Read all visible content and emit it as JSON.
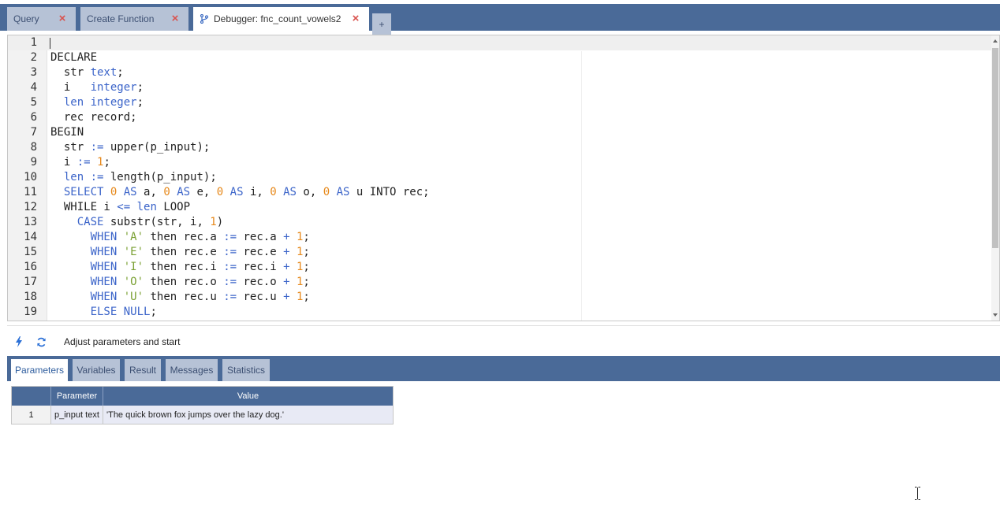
{
  "tabs": [
    {
      "label": "Query",
      "active": false
    },
    {
      "label": "Create Function",
      "active": false
    },
    {
      "label": "Debugger: fnc_count_vowels2",
      "active": true,
      "icon": "branch-icon"
    }
  ],
  "new_tab_label": "+",
  "editor": {
    "current_line": 1,
    "lines": [
      {
        "n": "1",
        "tokens": []
      },
      {
        "n": "2",
        "tokens": [
          [
            "DECLARE",
            ""
          ]
        ]
      },
      {
        "n": "3",
        "tokens": [
          [
            "  str ",
            ""
          ],
          [
            "text",
            "kw"
          ],
          [
            ";",
            ""
          ]
        ]
      },
      {
        "n": "4",
        "tokens": [
          [
            "  i   ",
            ""
          ],
          [
            "integer",
            "kw"
          ],
          [
            ";",
            ""
          ]
        ]
      },
      {
        "n": "5",
        "tokens": [
          [
            "  ",
            ""
          ],
          [
            "len",
            "kw"
          ],
          [
            " ",
            ""
          ],
          [
            "integer",
            "kw"
          ],
          [
            ";",
            ""
          ]
        ]
      },
      {
        "n": "6",
        "tokens": [
          [
            "  rec record;",
            ""
          ]
        ]
      },
      {
        "n": "7",
        "tokens": [
          [
            "BEGIN",
            ""
          ]
        ]
      },
      {
        "n": "8",
        "tokens": [
          [
            "  str ",
            ""
          ],
          [
            ":=",
            "kw"
          ],
          [
            " upper(p_input);",
            ""
          ]
        ]
      },
      {
        "n": "9",
        "tokens": [
          [
            "  i ",
            ""
          ],
          [
            ":=",
            "kw"
          ],
          [
            " ",
            ""
          ],
          [
            "1",
            "num"
          ],
          [
            ";",
            ""
          ]
        ]
      },
      {
        "n": "10",
        "tokens": [
          [
            "  ",
            ""
          ],
          [
            "len",
            "kw"
          ],
          [
            " ",
            ""
          ],
          [
            ":=",
            "kw"
          ],
          [
            " length(p_input);",
            ""
          ]
        ]
      },
      {
        "n": "11",
        "tokens": [
          [
            "  ",
            ""
          ],
          [
            "SELECT",
            "kw"
          ],
          [
            " ",
            ""
          ],
          [
            "0",
            "num"
          ],
          [
            " ",
            ""
          ],
          [
            "AS",
            "kw"
          ],
          [
            " a, ",
            ""
          ],
          [
            "0",
            "num"
          ],
          [
            " ",
            ""
          ],
          [
            "AS",
            "kw"
          ],
          [
            " e, ",
            ""
          ],
          [
            "0",
            "num"
          ],
          [
            " ",
            ""
          ],
          [
            "AS",
            "kw"
          ],
          [
            " i, ",
            ""
          ],
          [
            "0",
            "num"
          ],
          [
            " ",
            ""
          ],
          [
            "AS",
            "kw"
          ],
          [
            " o, ",
            ""
          ],
          [
            "0",
            "num"
          ],
          [
            " ",
            ""
          ],
          [
            "AS",
            "kw"
          ],
          [
            " u INTO rec;",
            ""
          ]
        ]
      },
      {
        "n": "12",
        "tokens": [
          [
            "  WHILE i ",
            ""
          ],
          [
            "<=",
            "kw"
          ],
          [
            " ",
            ""
          ],
          [
            "len",
            "kw"
          ],
          [
            " LOOP",
            ""
          ]
        ]
      },
      {
        "n": "13",
        "tokens": [
          [
            "    ",
            ""
          ],
          [
            "CASE",
            "kw"
          ],
          [
            " substr(str, i, ",
            ""
          ],
          [
            "1",
            "num"
          ],
          [
            ")",
            ""
          ]
        ]
      },
      {
        "n": "14",
        "tokens": [
          [
            "      ",
            ""
          ],
          [
            "WHEN",
            "kw"
          ],
          [
            " ",
            ""
          ],
          [
            "'A'",
            "str"
          ],
          [
            " then rec.a ",
            ""
          ],
          [
            ":=",
            "kw"
          ],
          [
            " rec.a ",
            ""
          ],
          [
            "+",
            "kw"
          ],
          [
            " ",
            ""
          ],
          [
            "1",
            "num"
          ],
          [
            ";",
            ""
          ]
        ]
      },
      {
        "n": "15",
        "tokens": [
          [
            "      ",
            ""
          ],
          [
            "WHEN",
            "kw"
          ],
          [
            " ",
            ""
          ],
          [
            "'E'",
            "str"
          ],
          [
            " then rec.e ",
            ""
          ],
          [
            ":=",
            "kw"
          ],
          [
            " rec.e ",
            ""
          ],
          [
            "+",
            "kw"
          ],
          [
            " ",
            ""
          ],
          [
            "1",
            "num"
          ],
          [
            ";",
            ""
          ]
        ]
      },
      {
        "n": "16",
        "tokens": [
          [
            "      ",
            ""
          ],
          [
            "WHEN",
            "kw"
          ],
          [
            " ",
            ""
          ],
          [
            "'I'",
            "str"
          ],
          [
            " then rec.i ",
            ""
          ],
          [
            ":=",
            "kw"
          ],
          [
            " rec.i ",
            ""
          ],
          [
            "+",
            "kw"
          ],
          [
            " ",
            ""
          ],
          [
            "1",
            "num"
          ],
          [
            ";",
            ""
          ]
        ]
      },
      {
        "n": "17",
        "tokens": [
          [
            "      ",
            ""
          ],
          [
            "WHEN",
            "kw"
          ],
          [
            " ",
            ""
          ],
          [
            "'O'",
            "str"
          ],
          [
            " then rec.o ",
            ""
          ],
          [
            ":=",
            "kw"
          ],
          [
            " rec.o ",
            ""
          ],
          [
            "+",
            "kw"
          ],
          [
            " ",
            ""
          ],
          [
            "1",
            "num"
          ],
          [
            ";",
            ""
          ]
        ]
      },
      {
        "n": "18",
        "tokens": [
          [
            "      ",
            ""
          ],
          [
            "WHEN",
            "kw"
          ],
          [
            " ",
            ""
          ],
          [
            "'U'",
            "str"
          ],
          [
            " then rec.u ",
            ""
          ],
          [
            ":=",
            "kw"
          ],
          [
            " rec.u ",
            ""
          ],
          [
            "+",
            "kw"
          ],
          [
            " ",
            ""
          ],
          [
            "1",
            "num"
          ],
          [
            ";",
            ""
          ]
        ]
      },
      {
        "n": "19",
        "tokens": [
          [
            "      ",
            ""
          ],
          [
            "ELSE",
            "kw"
          ],
          [
            " ",
            ""
          ],
          [
            "NULL",
            "kw"
          ],
          [
            ";",
            ""
          ]
        ]
      }
    ]
  },
  "toolbar": {
    "start_icon": "lightning-icon",
    "restart_icon": "refresh-icon",
    "status": "Adjust parameters and start"
  },
  "panel_tabs": [
    {
      "label": "Parameters",
      "active": true
    },
    {
      "label": "Variables",
      "active": false
    },
    {
      "label": "Result",
      "active": false
    },
    {
      "label": "Messages",
      "active": false
    },
    {
      "label": "Statistics",
      "active": false
    }
  ],
  "params_table": {
    "headers": [
      "",
      "Parameter",
      "Value"
    ],
    "rows": [
      {
        "index": "1",
        "parameter": "p_input text",
        "value": "'The quick brown fox jumps over the lazy dog.'"
      }
    ]
  },
  "colors": {
    "header_bar": "#4a6a98",
    "inactive_tab": "#b6c2d6",
    "keyword": "#3b64c9",
    "number": "#e6881a",
    "string": "#7aa033",
    "close": "#d9534f"
  }
}
